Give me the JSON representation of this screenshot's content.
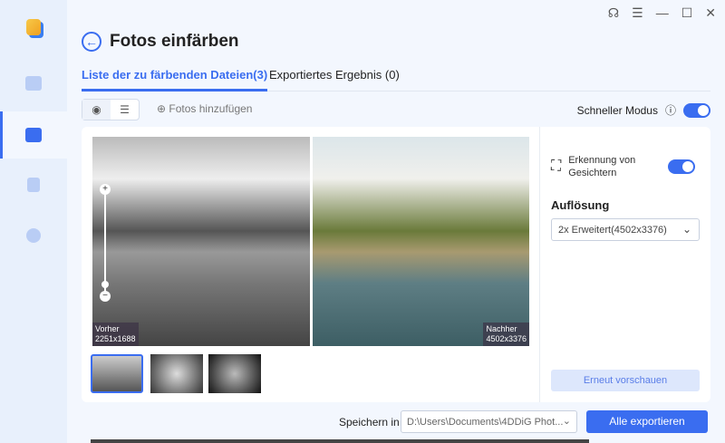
{
  "sidebar": {
    "items": [
      "logo",
      "video",
      "photo",
      "document",
      "music"
    ],
    "active": "photo"
  },
  "header": {
    "title": "Fotos einfärben"
  },
  "tabs": [
    {
      "label": "Liste der zu färbenden Dateien(3)",
      "active": true
    },
    {
      "label": "Exportiertes Ergebnis (0)",
      "active": false
    }
  ],
  "toolbar": {
    "add_label": "Fotos hinzufügen",
    "fast_mode_label": "Schneller Modus",
    "fast_mode_on": true
  },
  "preview": {
    "before_label": "Vorher",
    "before_size": "2251x1688",
    "after_label": "Nachher",
    "after_size": "4502x3376"
  },
  "thumbnails": [
    "Landschaft",
    "Blumen",
    "Porträt"
  ],
  "settings": {
    "face_label": "Erkennung von Gesichtern",
    "face_on": true,
    "resolution_label": "Auflösung",
    "resolution_value": "2x Erweitert(4502x3376)",
    "preview_button": "Erneut vorschauen"
  },
  "footer": {
    "save_label": "Speichern in",
    "save_path": "D:\\Users\\Documents\\4DDiG Phot...",
    "export_button": "Alle exportieren"
  },
  "colors": {
    "accent": "#3a6df0"
  }
}
